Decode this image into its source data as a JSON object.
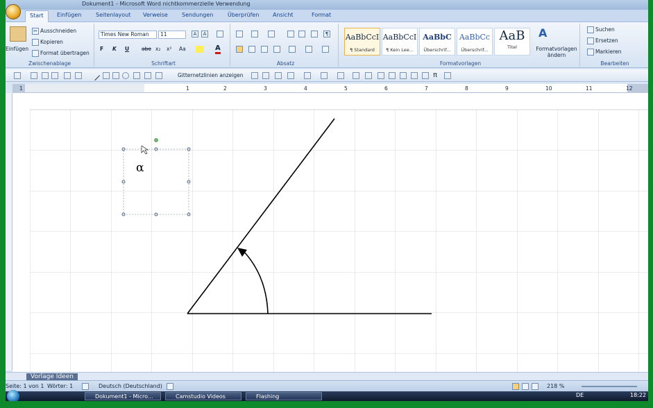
{
  "window": {
    "title": "Dokument1 - Microsoft Word nichtkommerzielle Verwendung"
  },
  "tabs": [
    "Start",
    "Einfügen",
    "Seitenlayout",
    "Verweise",
    "Sendungen",
    "Überprüfen",
    "Ansicht",
    "Format"
  ],
  "clipboard": {
    "paste": "Einfügen",
    "cut": "Ausschneiden",
    "copy": "Kopieren",
    "format_painter": "Format übertragen",
    "label": "Zwischenablage"
  },
  "font": {
    "family": "Times New Roman",
    "size": "11",
    "label": "Schriftart",
    "bold": "F",
    "italic": "K",
    "underline": "U",
    "strike": "abe",
    "sub": "x₂",
    "sup": "x²",
    "case": "Aa",
    "grow": "A",
    "shrink": "A"
  },
  "paragraph": {
    "label": "Absatz"
  },
  "styles": {
    "label": "Formatvorlagen",
    "items": [
      {
        "sample": "AaBbCcI",
        "name": "¶ Standard"
      },
      {
        "sample": "AaBbCcI",
        "name": "¶ Kein Lee..."
      },
      {
        "sample": "AaBbC",
        "name": "Überschrif..."
      },
      {
        "sample": "AaBbCc",
        "name": "Überschrif..."
      },
      {
        "sample": "AaB",
        "name": "Titel"
      }
    ],
    "change": "Formatvorlagen ändern"
  },
  "editing": {
    "label": "Bearbeiten",
    "find": "Suchen",
    "replace": "Ersetzen",
    "select": "Markieren"
  },
  "drawing_toolbar": {
    "grid_label": "Gitternetzlinien anzeigen"
  },
  "ruler": {
    "h_numbers": [
      "1",
      "1",
      "2",
      "3",
      "4",
      "5",
      "6",
      "7",
      "8",
      "9",
      "10",
      "11",
      "12"
    ]
  },
  "document": {
    "angle_symbol": "α"
  },
  "status": {
    "page": "Seite: 1 von 1",
    "words": "Wörter: 1",
    "language": "Deutsch (Deutschland)",
    "zoom": "218 %"
  },
  "bottom_tab": "Vorlage Ideen",
  "taskbar": {
    "tasks": [
      "Dokument1 - Micro...",
      "Camstudio Videos",
      "Flashing"
    ],
    "lang": "DE",
    "time": "18:22"
  },
  "colors": {
    "ribbon": "#d6e3f3",
    "accent": "#15428b",
    "taskbar": "#0f1a2e"
  }
}
